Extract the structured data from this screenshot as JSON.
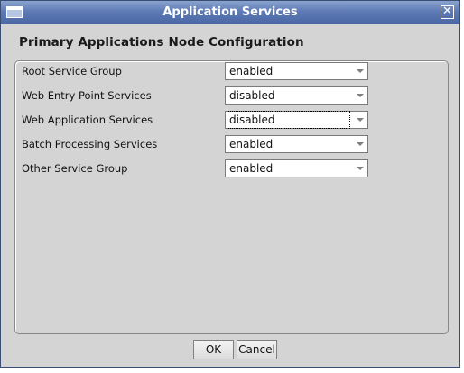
{
  "window": {
    "title": "Application Services",
    "close_glyph": "✕",
    "icons": {
      "system": "window-menu-icon",
      "close": "close-icon"
    }
  },
  "heading": "Primary Applications Node Configuration",
  "settings": [
    {
      "label": "Root Service Group",
      "value": "enabled"
    },
    {
      "label": "Web Entry Point Services",
      "value": "disabled"
    },
    {
      "label": "Web Application Services",
      "value": "disabled"
    },
    {
      "label": "Batch Processing Services",
      "value": "enabled"
    },
    {
      "label": "Other Service Group",
      "value": "enabled"
    }
  ],
  "buttons": {
    "ok": "OK",
    "cancel": "Cancel"
  },
  "colors": {
    "titlebar": "#5d7ab5",
    "background": "#d4d4d4"
  }
}
